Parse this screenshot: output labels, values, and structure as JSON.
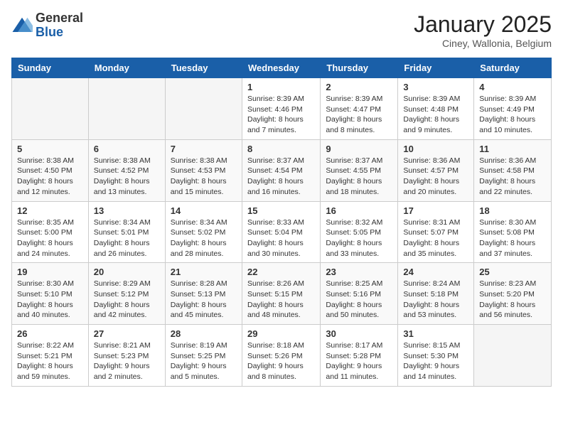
{
  "header": {
    "logo_general": "General",
    "logo_blue": "Blue",
    "month_title": "January 2025",
    "location": "Ciney, Wallonia, Belgium"
  },
  "weekdays": [
    "Sunday",
    "Monday",
    "Tuesday",
    "Wednesday",
    "Thursday",
    "Friday",
    "Saturday"
  ],
  "weeks": [
    [
      {
        "day": "",
        "info": ""
      },
      {
        "day": "",
        "info": ""
      },
      {
        "day": "",
        "info": ""
      },
      {
        "day": "1",
        "info": "Sunrise: 8:39 AM\nSunset: 4:46 PM\nDaylight: 8 hours\nand 7 minutes."
      },
      {
        "day": "2",
        "info": "Sunrise: 8:39 AM\nSunset: 4:47 PM\nDaylight: 8 hours\nand 8 minutes."
      },
      {
        "day": "3",
        "info": "Sunrise: 8:39 AM\nSunset: 4:48 PM\nDaylight: 8 hours\nand 9 minutes."
      },
      {
        "day": "4",
        "info": "Sunrise: 8:39 AM\nSunset: 4:49 PM\nDaylight: 8 hours\nand 10 minutes."
      }
    ],
    [
      {
        "day": "5",
        "info": "Sunrise: 8:38 AM\nSunset: 4:50 PM\nDaylight: 8 hours\nand 12 minutes."
      },
      {
        "day": "6",
        "info": "Sunrise: 8:38 AM\nSunset: 4:52 PM\nDaylight: 8 hours\nand 13 minutes."
      },
      {
        "day": "7",
        "info": "Sunrise: 8:38 AM\nSunset: 4:53 PM\nDaylight: 8 hours\nand 15 minutes."
      },
      {
        "day": "8",
        "info": "Sunrise: 8:37 AM\nSunset: 4:54 PM\nDaylight: 8 hours\nand 16 minutes."
      },
      {
        "day": "9",
        "info": "Sunrise: 8:37 AM\nSunset: 4:55 PM\nDaylight: 8 hours\nand 18 minutes."
      },
      {
        "day": "10",
        "info": "Sunrise: 8:36 AM\nSunset: 4:57 PM\nDaylight: 8 hours\nand 20 minutes."
      },
      {
        "day": "11",
        "info": "Sunrise: 8:36 AM\nSunset: 4:58 PM\nDaylight: 8 hours\nand 22 minutes."
      }
    ],
    [
      {
        "day": "12",
        "info": "Sunrise: 8:35 AM\nSunset: 5:00 PM\nDaylight: 8 hours\nand 24 minutes."
      },
      {
        "day": "13",
        "info": "Sunrise: 8:34 AM\nSunset: 5:01 PM\nDaylight: 8 hours\nand 26 minutes."
      },
      {
        "day": "14",
        "info": "Sunrise: 8:34 AM\nSunset: 5:02 PM\nDaylight: 8 hours\nand 28 minutes."
      },
      {
        "day": "15",
        "info": "Sunrise: 8:33 AM\nSunset: 5:04 PM\nDaylight: 8 hours\nand 30 minutes."
      },
      {
        "day": "16",
        "info": "Sunrise: 8:32 AM\nSunset: 5:05 PM\nDaylight: 8 hours\nand 33 minutes."
      },
      {
        "day": "17",
        "info": "Sunrise: 8:31 AM\nSunset: 5:07 PM\nDaylight: 8 hours\nand 35 minutes."
      },
      {
        "day": "18",
        "info": "Sunrise: 8:30 AM\nSunset: 5:08 PM\nDaylight: 8 hours\nand 37 minutes."
      }
    ],
    [
      {
        "day": "19",
        "info": "Sunrise: 8:30 AM\nSunset: 5:10 PM\nDaylight: 8 hours\nand 40 minutes."
      },
      {
        "day": "20",
        "info": "Sunrise: 8:29 AM\nSunset: 5:12 PM\nDaylight: 8 hours\nand 42 minutes."
      },
      {
        "day": "21",
        "info": "Sunrise: 8:28 AM\nSunset: 5:13 PM\nDaylight: 8 hours\nand 45 minutes."
      },
      {
        "day": "22",
        "info": "Sunrise: 8:26 AM\nSunset: 5:15 PM\nDaylight: 8 hours\nand 48 minutes."
      },
      {
        "day": "23",
        "info": "Sunrise: 8:25 AM\nSunset: 5:16 PM\nDaylight: 8 hours\nand 50 minutes."
      },
      {
        "day": "24",
        "info": "Sunrise: 8:24 AM\nSunset: 5:18 PM\nDaylight: 8 hours\nand 53 minutes."
      },
      {
        "day": "25",
        "info": "Sunrise: 8:23 AM\nSunset: 5:20 PM\nDaylight: 8 hours\nand 56 minutes."
      }
    ],
    [
      {
        "day": "26",
        "info": "Sunrise: 8:22 AM\nSunset: 5:21 PM\nDaylight: 8 hours\nand 59 minutes."
      },
      {
        "day": "27",
        "info": "Sunrise: 8:21 AM\nSunset: 5:23 PM\nDaylight: 9 hours\nand 2 minutes."
      },
      {
        "day": "28",
        "info": "Sunrise: 8:19 AM\nSunset: 5:25 PM\nDaylight: 9 hours\nand 5 minutes."
      },
      {
        "day": "29",
        "info": "Sunrise: 8:18 AM\nSunset: 5:26 PM\nDaylight: 9 hours\nand 8 minutes."
      },
      {
        "day": "30",
        "info": "Sunrise: 8:17 AM\nSunset: 5:28 PM\nDaylight: 9 hours\nand 11 minutes."
      },
      {
        "day": "31",
        "info": "Sunrise: 8:15 AM\nSunset: 5:30 PM\nDaylight: 9 hours\nand 14 minutes."
      },
      {
        "day": "",
        "info": ""
      }
    ]
  ]
}
